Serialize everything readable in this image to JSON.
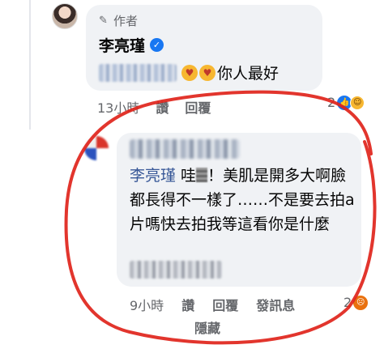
{
  "comment1": {
    "author_tag": "作者",
    "author_tag_icon": "pen-icon",
    "name": "李亮瑾",
    "verified_icon": "verified-badge-icon",
    "blurred_mention": "",
    "emojis": [
      "smiling-face-with-hearts-emoji",
      "smiling-face-with-hearts-emoji"
    ],
    "text": "你人最好",
    "time": "13小時",
    "like_label": "讚",
    "reply_label": "回覆",
    "reaction_count": "2",
    "reaction_icons": [
      "like-icon",
      "haha-icon"
    ]
  },
  "comment2": {
    "mention": "李亮瑾",
    "text_start": " 哇",
    "text_rest": "！美肌是開多大啊臉都長得不一樣了……不是要去拍a片嗎快去拍我等這看你是什麼",
    "time": "9小時",
    "like_label": "讚",
    "reply_label": "回覆",
    "message_label": "發訊息",
    "reaction_count": "2",
    "reaction_icons": [
      "angry-icon"
    ],
    "hide_label": "隱藏"
  },
  "colors": {
    "bubble": "#f0f2f5",
    "meta_text": "#65676b",
    "mention": "#385898",
    "highlight_circle": "#e0241b",
    "facebook_blue": "#1877f2"
  }
}
